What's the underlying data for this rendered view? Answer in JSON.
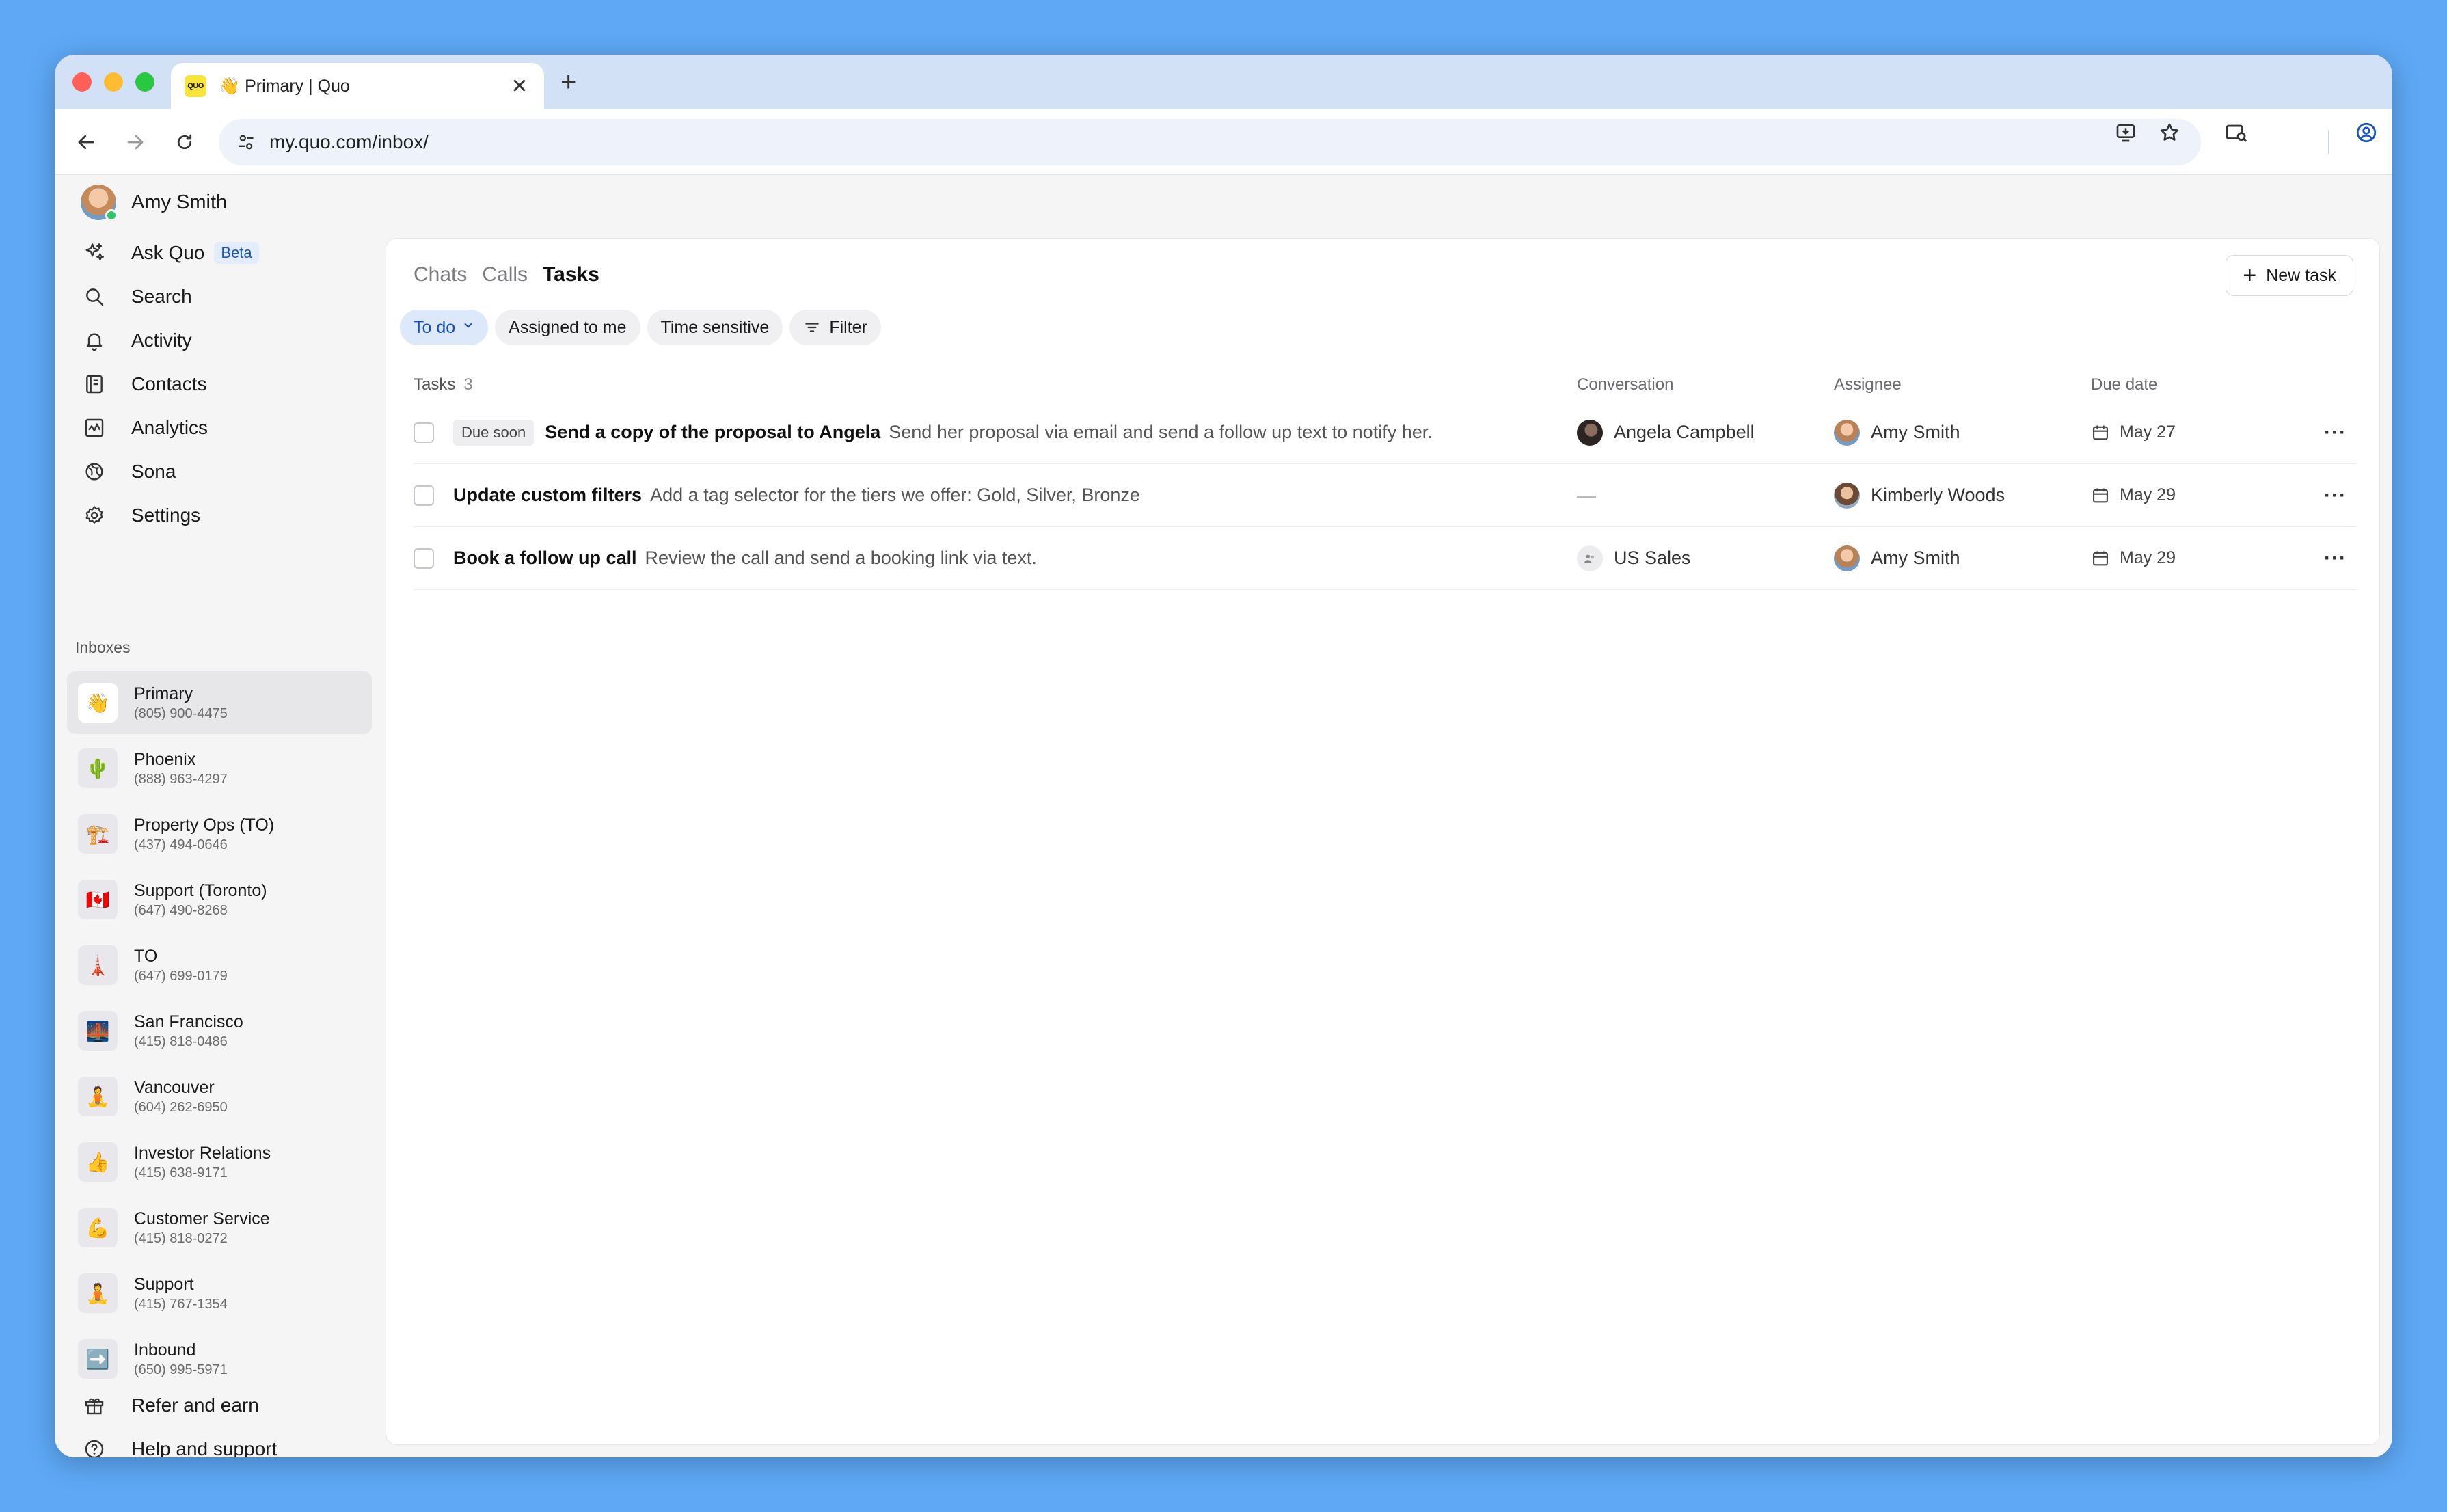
{
  "browser": {
    "tab_favicon_text": "QUO",
    "tab_title": "👋 Primary | Quo",
    "tab_close": "✕",
    "new_tab": "+",
    "url": "my.quo.com/inbox/"
  },
  "sidebar": {
    "user_name": "Amy Smith",
    "nav": [
      {
        "label": "Ask Quo",
        "icon": "sparkles-icon",
        "badge": "Beta"
      },
      {
        "label": "Search",
        "icon": "search-icon"
      },
      {
        "label": "Activity",
        "icon": "bell-icon"
      },
      {
        "label": "Contacts",
        "icon": "contacts-icon"
      },
      {
        "label": "Analytics",
        "icon": "analytics-icon"
      },
      {
        "label": "Sona",
        "icon": "sona-icon"
      },
      {
        "label": "Settings",
        "icon": "gear-icon"
      }
    ],
    "inboxes_heading": "Inboxes",
    "inboxes": [
      {
        "name": "Primary",
        "number": "(805) 900-4475",
        "emoji": "👋"
      },
      {
        "name": "Phoenix",
        "number": "(888) 963-4297",
        "emoji": "🌵"
      },
      {
        "name": "Property Ops (TO)",
        "number": "(437) 494-0646",
        "emoji": "🏗️"
      },
      {
        "name": "Support (Toronto)",
        "number": "(647) 490-8268",
        "emoji": "🇨🇦"
      },
      {
        "name": "TO",
        "number": "(647) 699-0179",
        "emoji": "🗼"
      },
      {
        "name": "San Francisco",
        "number": "(415) 818-0486",
        "emoji": "🌉"
      },
      {
        "name": "Vancouver",
        "number": "(604) 262-6950",
        "emoji": "🧘"
      },
      {
        "name": "Investor Relations",
        "number": "(415) 638-9171",
        "emoji": "👍"
      },
      {
        "name": "Customer Service",
        "number": "(415) 818-0272",
        "emoji": "💪"
      },
      {
        "name": "Support",
        "number": "(415) 767-1354",
        "emoji": "🧘"
      },
      {
        "name": "Inbound",
        "number": "(650) 995-5971",
        "emoji": "➡️"
      }
    ],
    "bottom": [
      {
        "label": "Refer and earn",
        "icon": "gift-icon"
      },
      {
        "label": "Help and support",
        "icon": "help-icon"
      }
    ]
  },
  "main": {
    "tabs": [
      "Chats",
      "Calls",
      "Tasks"
    ],
    "active_tab": "Tasks",
    "new_task_label": "New task",
    "filters": {
      "status": "To do",
      "assigned": "Assigned to me",
      "time_sensitive": "Time sensitive",
      "filter": "Filter"
    },
    "table": {
      "headers": {
        "tasks": "Tasks",
        "count": "3",
        "conversation": "Conversation",
        "assignee": "Assignee",
        "due": "Due date"
      },
      "rows": [
        {
          "badge": "Due soon",
          "title": "Send a copy of the proposal to Angela",
          "description": "Send her proposal via email and send a follow up text to notify her.",
          "conversation": "Angela Campbell",
          "assignee": "Amy Smith",
          "due": "May 27"
        },
        {
          "badge": "",
          "title": "Update custom filters",
          "description": "Add a tag selector for the tiers we offer: Gold, Silver, Bronze",
          "conversation": "—",
          "assignee": "Kimberly Woods",
          "due": "May 29"
        },
        {
          "badge": "",
          "title": "Book a follow up call",
          "description": "Review the call and send a booking link via text.",
          "conversation": "US Sales",
          "assignee": "Amy Smith",
          "due": "May 29"
        }
      ],
      "more_label": "···"
    }
  },
  "colors": {
    "background": "#5ea8f5",
    "accent": "#1850c4",
    "online": "#2ec56a"
  }
}
